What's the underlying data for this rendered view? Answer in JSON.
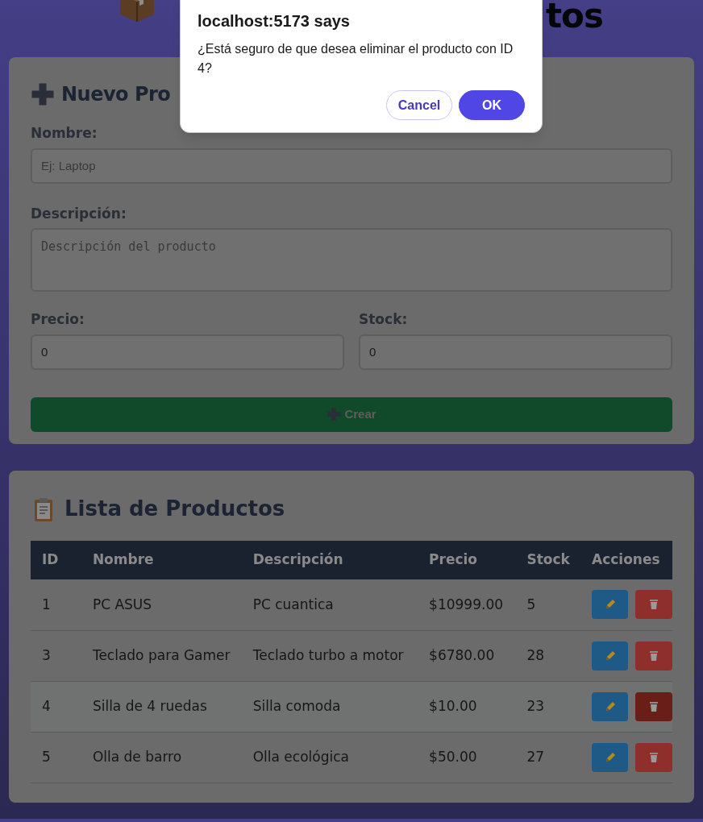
{
  "page_title_visible_end": "tos",
  "dialog": {
    "title": "localhost:5173 says",
    "message": "¿Está seguro de que desea eliminar el producto con ID 4?",
    "buttons": [
      {
        "label": "Cancel",
        "kind": "secondary"
      },
      {
        "label": "OK",
        "kind": "primary"
      }
    ]
  },
  "form": {
    "title": "Nuevo Pro",
    "fields": [
      {
        "label": "Nombre:",
        "kind": "text",
        "placeholder": "Ej: Laptop"
      },
      {
        "label": "Descripción:",
        "kind": "textarea",
        "placeholder": "Descripción del producto"
      }
    ],
    "number_fields": [
      {
        "label": "Precio:",
        "value": "0"
      },
      {
        "label": "Stock:",
        "value": "0"
      }
    ],
    "submit": "Crear"
  },
  "list": {
    "title": "Lista de Productos",
    "columns": [
      "ID",
      "Nombre",
      "Descripción",
      "Precio",
      "Stock",
      "Acciones"
    ],
    "rows": [
      {
        "cells": [
          "1",
          "PC ASUS",
          "PC cuantica",
          "$10999.00",
          "5"
        ],
        "highlighted": false
      },
      {
        "cells": [
          "3",
          "Teclado para Gamer",
          "Teclado turbo a motor",
          "$6780.00",
          "28"
        ],
        "highlighted": false
      },
      {
        "cells": [
          "4",
          "Silla de 4 ruedas",
          "Silla comoda",
          "$10.00",
          "23"
        ],
        "highlighted": true
      },
      {
        "cells": [
          "5",
          "Olla de barro",
          "Olla ecológica",
          "$50.00",
          "27"
        ],
        "highlighted": false
      }
    ]
  }
}
